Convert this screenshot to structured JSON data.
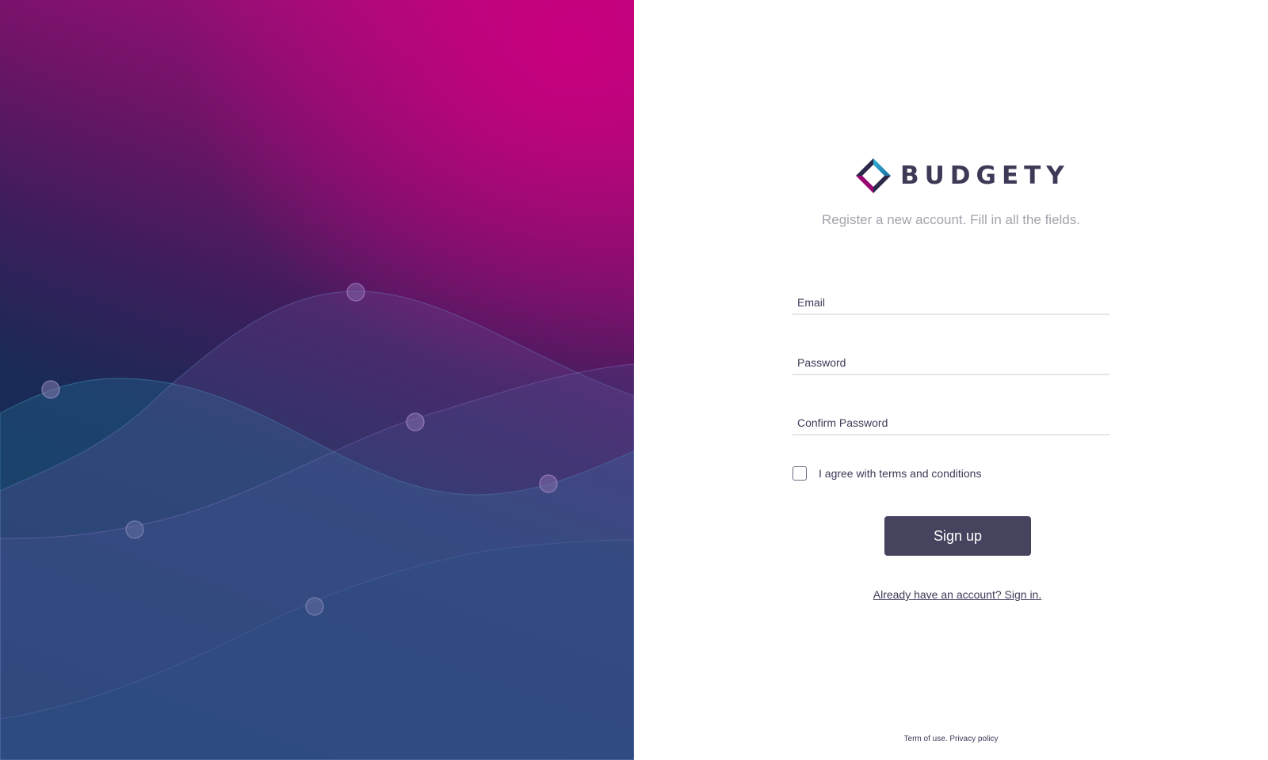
{
  "brand": {
    "name": "BUDGETY",
    "logo_icon": "diamond-logo-icon",
    "colors": {
      "cyan": "#2fb5d8",
      "magenta": "#c5007e",
      "navy": "#2c2a4a"
    }
  },
  "subtitle": "Register a new account. Fill in all the fields.",
  "form": {
    "email_placeholder": "Email",
    "password_placeholder": "Password",
    "confirm_placeholder": "Confirm Password",
    "agree_label": "I agree with terms and conditions",
    "agree_checked": false,
    "signup_label": "Sign up",
    "signin_link": "Already have an account? Sign in."
  },
  "footer": {
    "terms": "Term of use.",
    "privacy": "Privacy policy"
  },
  "theme": {
    "text": "#3d3a57",
    "muted": "#a3a3ad",
    "button": "#45435d",
    "gradient_top": "#c9007f",
    "gradient_bottom": "#08294f"
  }
}
